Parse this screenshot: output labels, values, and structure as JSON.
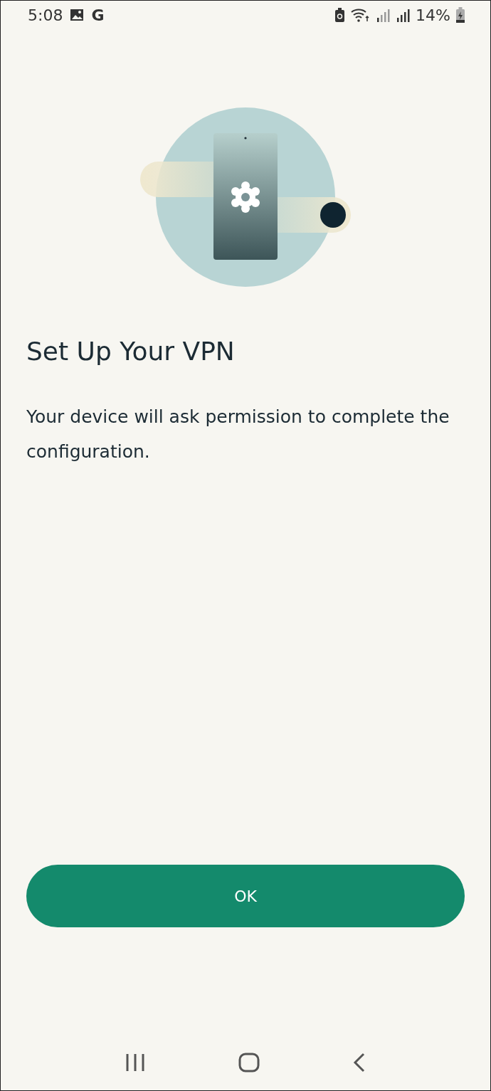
{
  "status_bar": {
    "time": "5:08",
    "app_letter": "G",
    "battery": "14%"
  },
  "title": "Set Up Your VPN",
  "message": "Your device will ask permission to complete the configuration.",
  "button": {
    "label": "OK"
  }
}
